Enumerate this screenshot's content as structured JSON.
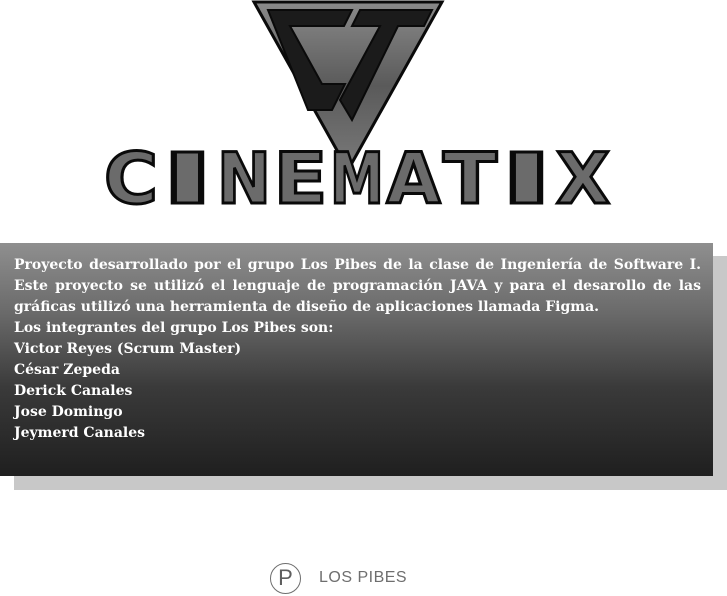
{
  "logo": {
    "monogram": "CT",
    "wordmark": "CINEMATIX",
    "wordmark_letters": [
      "C",
      "I",
      "N",
      "E",
      "M",
      "A",
      "T",
      "I",
      "X"
    ],
    "colors": {
      "fill": "#6b6b6b",
      "outline": "#0a0a0a"
    }
  },
  "panel": {
    "description": "Proyecto desarrollado por el grupo Los Pibes de la clase de Ingeniería de Software I. Este proyecto se utilizó el lenguaje de programación JAVA y para el desarollo de las gráficas utilizó una herramienta de diseño de aplicaciones llamada Figma.",
    "members_heading": "Los integrantes del grupo Los Pibes son:",
    "members": [
      "Victor Reyes (Scrum Master)",
      "César Zepeda",
      "Derick Canales",
      "Jose Domingo",
      "Jeymerd Canales"
    ]
  },
  "footer": {
    "badge_letter": "P",
    "brand": "LOS PIBES"
  }
}
